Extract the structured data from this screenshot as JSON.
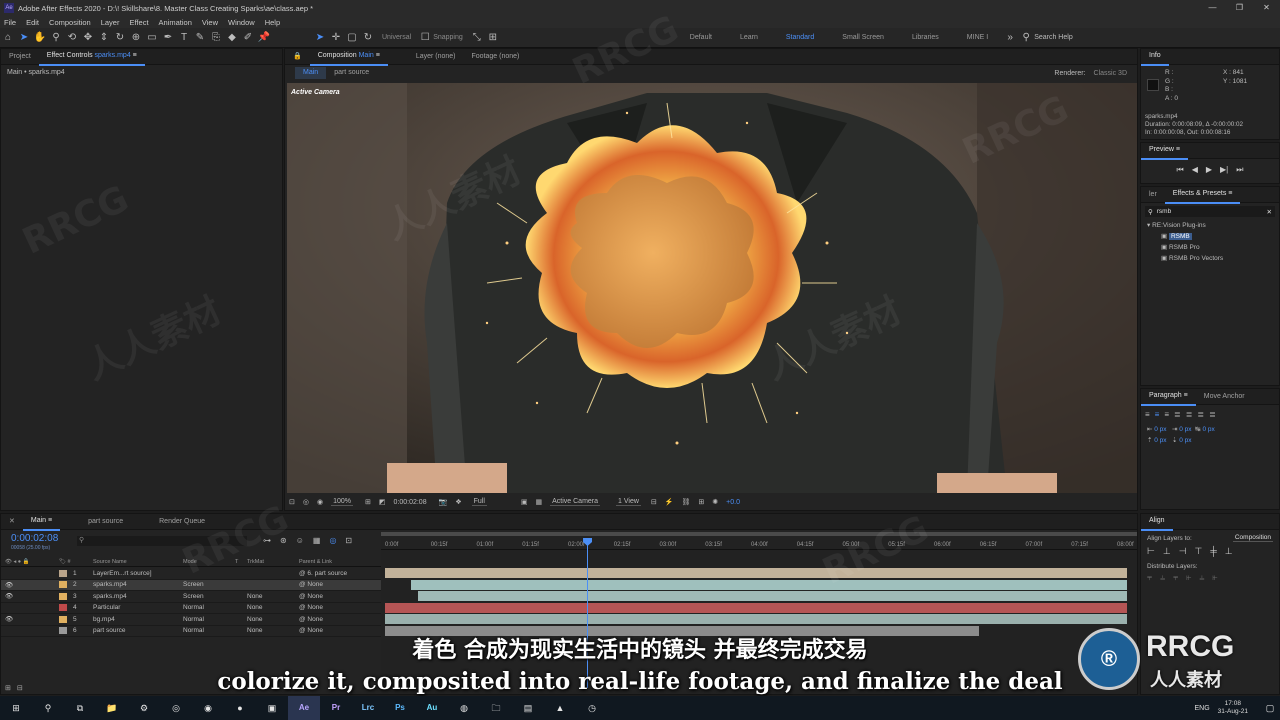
{
  "titlebar": {
    "logo": "Ae",
    "title": "Adobe After Effects 2020 - D:\\! Skillshare\\8. Master Class Creating Sparks\\ae\\class.aep *",
    "min": "—",
    "max": "❐",
    "close": "✕"
  },
  "menu": [
    "File",
    "Edit",
    "Composition",
    "Layer",
    "Effect",
    "Animation",
    "View",
    "Window",
    "Help"
  ],
  "toolbar": {
    "universal": "Universal",
    "snapping": "Snapping",
    "workspaces": [
      "Default",
      "Learn",
      "Standard",
      "Small Screen",
      "Libraries",
      "MINE I"
    ],
    "active_workspace": "Standard",
    "search_placeholder": "Search Help"
  },
  "left_panel": {
    "tab_project": "Project",
    "tab_effect_controls": "Effect Controls",
    "tab_effect_controls_layer": "sparks.mp4",
    "breadcrumb": "Main • sparks.mp4"
  },
  "comp_panel": {
    "tab_label": "Composition",
    "tab_comp_name": "Main",
    "layer_label": "Layer (none)",
    "footage_label": "Footage (none)",
    "subtabs": [
      "Main",
      "part source"
    ],
    "renderer_label": "Renderer:",
    "renderer_value": "Classic 3D",
    "camera_label": "Active Camera",
    "bottom": {
      "zoom": "100%",
      "timecode": "0:00:02:08",
      "resolution": "Full",
      "camera": "Active Camera",
      "view": "1 View",
      "exposure": "+0.0"
    }
  },
  "info_panel": {
    "title": "Info",
    "channels": [
      "R :",
      "G :",
      "B :",
      "A : 0"
    ],
    "x": "X : 841",
    "y": "Y : 1081",
    "file": "sparks.mp4",
    "duration": "Duration: 0:00:08:09, Δ -0:00:00:02",
    "inout": "In: 0:00:00:08, Out: 0:00:08:16"
  },
  "preview_panel": {
    "title": "Preview"
  },
  "effects_panel": {
    "tab_left": "ler",
    "title": "Effects & Presets",
    "search_value": "rsmb",
    "group": "RE:Vision Plug-ins",
    "items": [
      "RSMB",
      "RSMB Pro",
      "RSMB Pro Vectors"
    ]
  },
  "paragraph_panel": {
    "title": "Paragraph",
    "tab2": "Move Anchor",
    "fields": [
      "0 px",
      "0 px",
      "0 px",
      "0 px",
      "0 px"
    ]
  },
  "align_panel": {
    "title": "Align",
    "align_to_label": "Align Layers to:",
    "align_to_value": "Composition",
    "distribute": "Distribute Layers:"
  },
  "timeline": {
    "tabs": [
      "Main",
      "part source",
      "Render Queue"
    ],
    "timecode": "0:00:02:08",
    "timecode_sub": "00058 (25.00 fps)",
    "columns": {
      "num": "#",
      "source": "Source Name",
      "mode": "Mode",
      "t": "T",
      "trkmat": "TrkMat",
      "parent": "Parent & Link"
    },
    "ruler": [
      "0:00f",
      "00:15f",
      "01:00f",
      "01:15f",
      "02:00f",
      "02:15f",
      "03:00f",
      "03:15f",
      "04:00f",
      "04:15f",
      "05:00f",
      "05:15f",
      "06:00f",
      "06:15f",
      "07:00f",
      "07:15f",
      "08:00f"
    ],
    "playhead_fraction": 0.276,
    "layers": [
      {
        "num": "1",
        "name": "LayerEm...rt source]",
        "mode": "",
        "trkmat": "",
        "parent": "6. part source",
        "color": "#b9a48a",
        "start": 0.0,
        "end": 1.0,
        "bar": "#c2b29a"
      },
      {
        "num": "2",
        "name": "sparks.mp4",
        "mode": "Screen",
        "trkmat": "",
        "parent": "None",
        "color": "#e0b060",
        "start": 0.035,
        "end": 1.0,
        "bar": "#9fc0bd"
      },
      {
        "num": "3",
        "name": "sparks.mp4",
        "mode": "Screen",
        "trkmat": "None",
        "parent": "None",
        "color": "#e0b060",
        "start": 0.045,
        "end": 1.0,
        "bar": "#9fb9b6"
      },
      {
        "num": "4",
        "name": "Particular",
        "mode": "Normal",
        "trkmat": "None",
        "parent": "None",
        "color": "#c04a4a",
        "start": 0.0,
        "end": 1.0,
        "bar": "#b55555"
      },
      {
        "num": "5",
        "name": "bg.mp4",
        "mode": "Normal",
        "trkmat": "None",
        "parent": "None",
        "color": "#e0b060",
        "start": 0.0,
        "end": 1.0,
        "bar": "#9ab0ad"
      },
      {
        "num": "6",
        "name": "part source",
        "mode": "Normal",
        "trkmat": "None",
        "parent": "None",
        "color": "#9a9a9a",
        "start": 0.0,
        "end": 0.8,
        "bar": "#8c8c8c"
      }
    ]
  },
  "subtitles": {
    "cn": "着色 合成为现实生活中的镜头 并最终完成交易",
    "en": "colorize it, composited into real-life footage, and finalize the deal"
  },
  "watermarks": [
    "RRCG",
    "人人素材"
  ],
  "brand": {
    "logo_text": "RRCG",
    "logo_sub": "人人素材"
  },
  "taskbar": {
    "apps": [
      "Ae",
      "Pr",
      "Lrc",
      "Ps",
      "Au"
    ],
    "lang": "ENG",
    "time": "17:08",
    "date": "31-Aug-21"
  }
}
